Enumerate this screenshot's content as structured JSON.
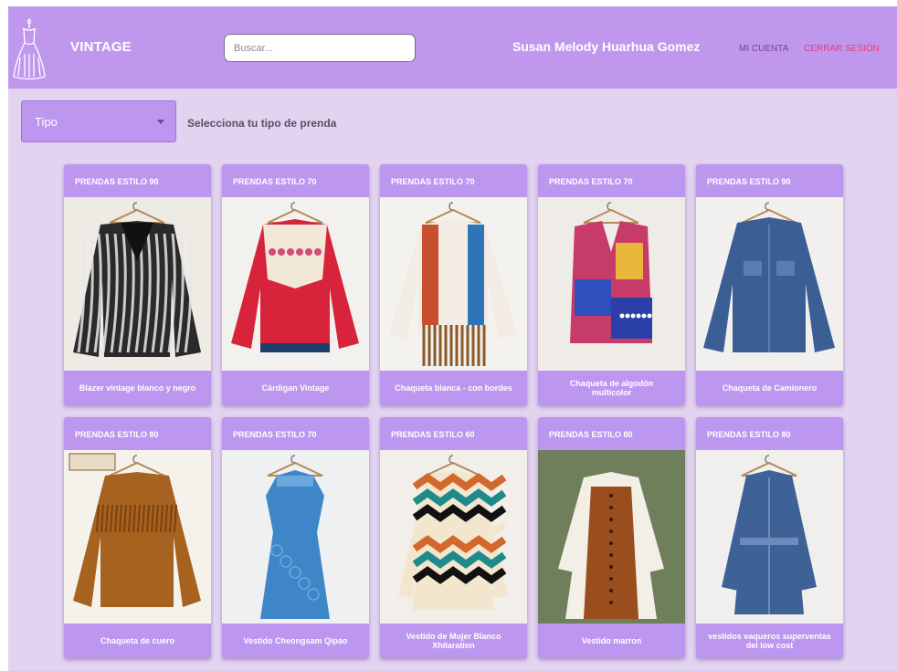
{
  "header": {
    "brand": "VINTAGE",
    "search_placeholder": "Buscar...",
    "user_name": "Susan Melody Huarhua Gomez",
    "account_link": "MI CUENTA",
    "logout_link": "CERRAR SESIÓN"
  },
  "filter": {
    "select_label": "Tipo",
    "hint": "Selecciona tu tipo de prenda"
  },
  "products": [
    {
      "category": "PRENDAS ESTILO 90",
      "name": "Blazer vintage blanco y negro",
      "icon": "blazer-icon",
      "color": "#2a2a2a",
      "accent": "#e8e8e8"
    },
    {
      "category": "PRENDAS ESTILO 70",
      "name": "Cárdigan Vintage",
      "icon": "sweater-icon",
      "color": "#d8243a",
      "accent": "#f1e8d8"
    },
    {
      "category": "PRENDAS ESTILO 70",
      "name": "Chaqueta blanca - con bordes",
      "icon": "fringe-jacket-icon",
      "color": "#f2ece4",
      "accent": "#8a5a2b"
    },
    {
      "category": "PRENDAS ESTILO 70",
      "name": "Chaqueta de algodón multicolor",
      "icon": "vest-icon",
      "color": "#c73b6b",
      "accent": "#2f4fbf"
    },
    {
      "category": "PRENDAS ESTILO 90",
      "name": "Chaqueta de Camionero",
      "icon": "denim-jacket-icon",
      "color": "#3b5f95",
      "accent": "#5a7db3"
    },
    {
      "category": "PRENDAS ESTILO 80",
      "name": "Chaqueta de cuero",
      "icon": "leather-jacket-icon",
      "color": "#a8621f",
      "accent": "#7a420f"
    },
    {
      "category": "PRENDAS ESTILO 70",
      "name": "Vestido Cheongsam Qipao",
      "icon": "dress-icon",
      "color": "#3f86c8",
      "accent": "#6aa7dc"
    },
    {
      "category": "PRENDAS ESTILO 60",
      "name": "Vestido de Mujer Blanco Xhilaration",
      "icon": "chevron-dress-icon",
      "color": "#d2682a",
      "accent": "#1f8a8a"
    },
    {
      "category": "PRENDAS ESTILO 80",
      "name": "Vestido marron",
      "icon": "pinafore-dress-icon",
      "color": "#9a4e1e",
      "accent": "#f3efe6"
    },
    {
      "category": "PRENDAS ESTILO 80",
      "name": "vestidos vaqueros superventas del low cost",
      "icon": "denim-dress-icon",
      "color": "#3f6296",
      "accent": "#6d8bbd"
    }
  ]
}
